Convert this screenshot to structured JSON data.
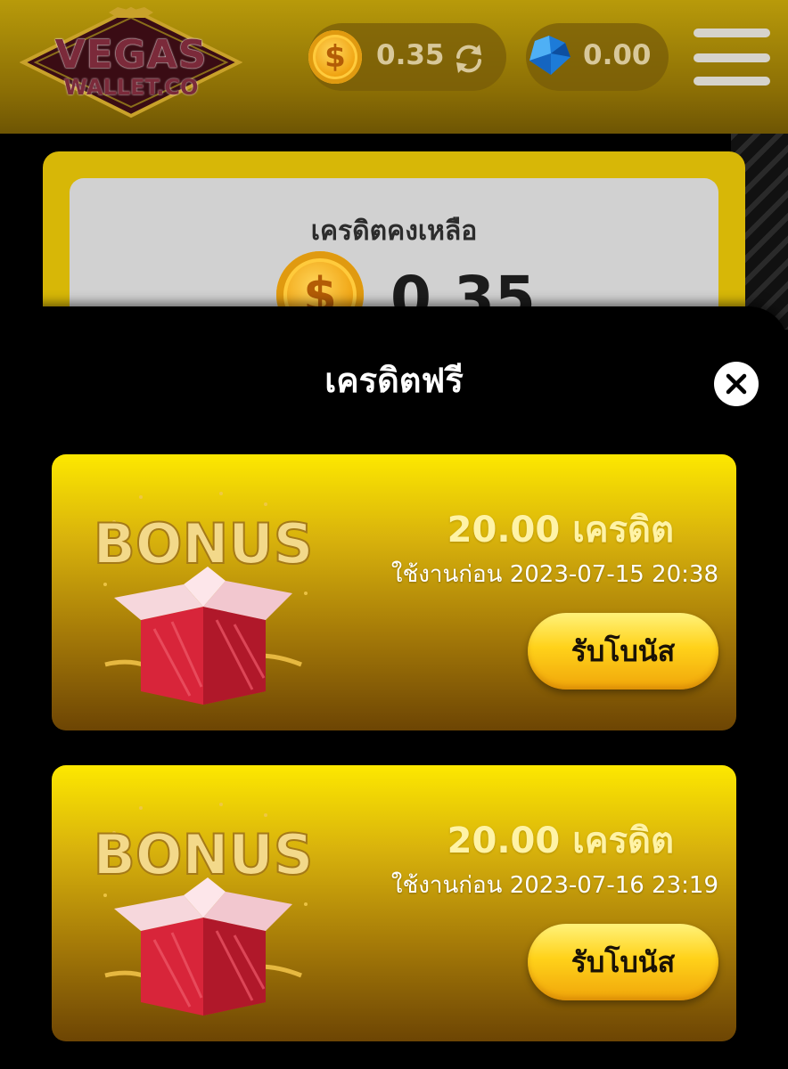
{
  "header": {
    "logo": {
      "line1": "VEGAS",
      "line2": "WALLET.CO"
    },
    "credit_balance": "0.35",
    "gem_balance": "0.00",
    "coin_symbol": "$"
  },
  "balance_card": {
    "label": "เครดิตคงเหลือ",
    "value": "0.35",
    "coin_symbol": "$"
  },
  "modal": {
    "title": "เครดิตฟรี",
    "bonuses": [
      {
        "art_text": "BONUS",
        "amount": "20.00 เครดิต",
        "expire": "ใช้งานก่อน 2023-07-15 20:38",
        "button": "รับโบนัส"
      },
      {
        "art_text": "BONUS",
        "amount": "20.00 เครดิต",
        "expire": "ใช้งานก่อน 2023-07-16 23:19",
        "button": "รับโบนัส"
      }
    ]
  },
  "colors": {
    "header": "#a88a08",
    "card_top": "#fde800",
    "card_bottom": "#6d4504",
    "button": "#ffd21a",
    "modal_bg": "#000000"
  },
  "icons": [
    "coin-icon",
    "refresh-icon",
    "gem-icon",
    "menu-icon",
    "close-icon",
    "gift-box-icon"
  ]
}
